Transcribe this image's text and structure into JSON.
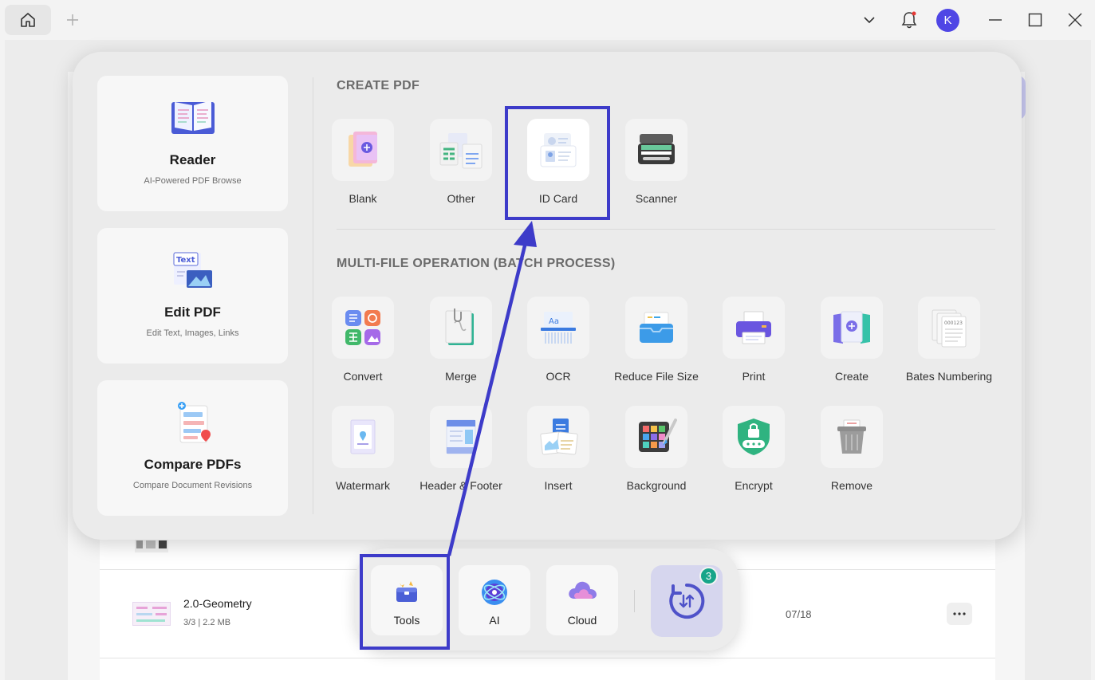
{
  "titlebar": {
    "avatar_letter": "K"
  },
  "side_cards": [
    {
      "title": "Reader",
      "subtitle": "AI-Powered PDF Browse"
    },
    {
      "title": "Edit PDF",
      "subtitle": "Edit Text, Images, Links",
      "icon_text": "Text"
    },
    {
      "title": "Compare PDFs",
      "subtitle": "Compare Document Revisions"
    }
  ],
  "create_pdf": {
    "title": "CREATE PDF",
    "tools": [
      {
        "label": "Blank"
      },
      {
        "label": "Other"
      },
      {
        "label": "ID Card"
      },
      {
        "label": "Scanner"
      }
    ]
  },
  "batch": {
    "title": "MULTI-FILE OPERATION (BATCH PROCESS)",
    "tools": [
      {
        "label": "Convert"
      },
      {
        "label": "Merge"
      },
      {
        "label": "OCR"
      },
      {
        "label": "Reduce File Size"
      },
      {
        "label": "Print"
      },
      {
        "label": "Create"
      },
      {
        "label": "Bates Numbering"
      },
      {
        "label": "Watermark"
      },
      {
        "label": "Header & Footer"
      },
      {
        "label": "Insert"
      },
      {
        "label": "Background"
      },
      {
        "label": "Encrypt"
      },
      {
        "label": "Remove"
      }
    ]
  },
  "file_list": {
    "rows": [
      {
        "name": "2.0-Geometry",
        "meta": "3/3 | 2.2 MB",
        "date": "07/18"
      }
    ]
  },
  "dock": {
    "tools_label": "Tools",
    "ai_label": "AI",
    "cloud_label": "Cloud",
    "sync_badge": "3"
  },
  "colors": {
    "highlight": "#3d3bc9",
    "avatar": "#4f46e5",
    "badge": "#17a589"
  }
}
